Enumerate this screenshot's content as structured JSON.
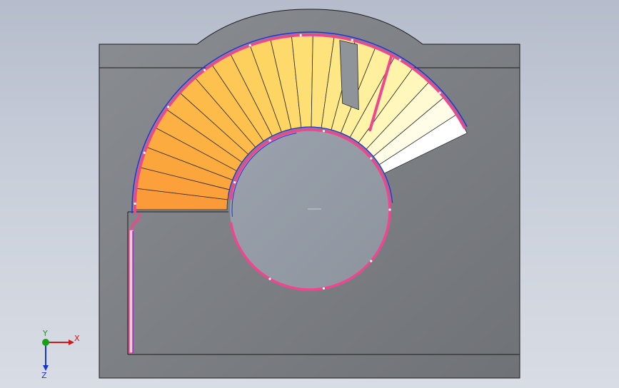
{
  "viewport": {
    "background_top": "#b5bccb",
    "background_bottom": "#d8dce4"
  },
  "model": {
    "body_color": "#7b7e83",
    "outline_color": "#1c1c1c",
    "stair_colors": [
      "#fa9a38",
      "#fcae40",
      "#fdc24e",
      "#fdd866",
      "#fee886",
      "#fff6b0",
      "#ffffff"
    ],
    "rail_colors": {
      "handrail": "#f0458f",
      "edge": "#2a2fd8"
    }
  },
  "triad": {
    "x_label": "X",
    "y_label": "Y",
    "z_label": "Z"
  }
}
